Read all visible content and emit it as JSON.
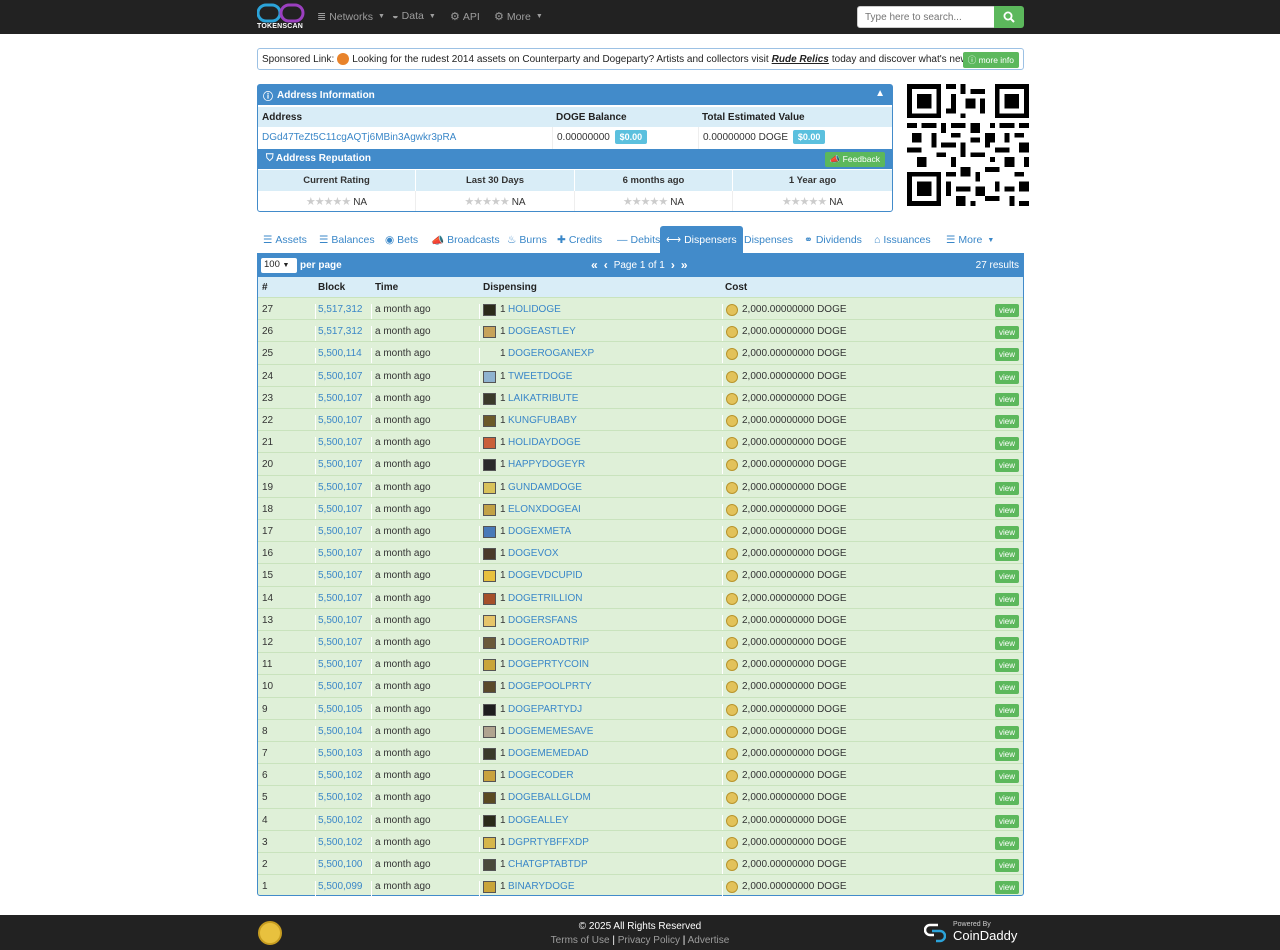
{
  "nav": {
    "logo_text": "TOKENSCAN",
    "items": [
      {
        "label": "Networks",
        "icon": "database-icon",
        "caret": true
      },
      {
        "label": "Data",
        "icon": "dashboard-icon",
        "caret": true
      },
      {
        "label": "API",
        "icon": "gears-icon",
        "caret": false
      },
      {
        "label": "More",
        "icon": "gear-icon",
        "caret": true
      }
    ],
    "search_placeholder": "Type here to search..."
  },
  "sponsor": {
    "prefix": "Sponsored Link:",
    "text_before": "Looking for the rudest 2014 assets on Counterparty and Dogeparty? Artists and collectors visit",
    "link": "Rude Relics",
    "text_after": "today and discover what's new!",
    "button": "more info"
  },
  "address_info": {
    "title": "Address Information",
    "headers": {
      "address": "Address",
      "balance": "DOGE Balance",
      "total": "Total Estimated Value"
    },
    "address": "DGd47TeZt5C11cgAQTj6MBin3Agwkr3pRA",
    "balance": "0.00000000",
    "balance_usd": "$0.00",
    "total": "0.00000000 DOGE",
    "total_usd": "$0.00"
  },
  "reputation": {
    "title": "Address Reputation",
    "feedback_button": "Feedback",
    "columns": [
      "Current Rating",
      "Last 30 Days",
      "6 months ago",
      "1 Year ago"
    ],
    "values": [
      "NA",
      "NA",
      "NA",
      "NA"
    ]
  },
  "tabs": [
    {
      "label": "Assets",
      "icon": "assets-icon"
    },
    {
      "label": "Balances",
      "icon": "list-icon"
    },
    {
      "label": "Bets",
      "icon": "bets-icon"
    },
    {
      "label": "Broadcasts",
      "icon": "bullhorn-icon"
    },
    {
      "label": "Burns",
      "icon": "fire-icon"
    },
    {
      "label": "Credits",
      "icon": "plus-icon"
    },
    {
      "label": "Debits",
      "icon": "minus-icon"
    },
    {
      "label": "Dispensers",
      "icon": "arrows-icon"
    },
    {
      "label": "Dispenses",
      "icon": ""
    },
    {
      "label": "Dividends",
      "icon": "sitemap-icon"
    },
    {
      "label": "Issuances",
      "icon": "bank-icon"
    },
    {
      "label": "More",
      "icon": "list-icon"
    }
  ],
  "active_tab": "Dispensers",
  "table": {
    "per_page": "100",
    "per_page_label": "per page",
    "page_info": "Page 1 of 1",
    "results": "27 results",
    "columns": [
      "#",
      "Block",
      "Time",
      "Dispensing",
      "Cost"
    ],
    "view_label": "view",
    "rows": [
      {
        "n": "27",
        "block": "5,517,312",
        "time": "a month ago",
        "qty": "1",
        "asset": "HOLIDOGE",
        "cost": "2,000.00000000 DOGE",
        "icon_color": "#2b2b1a"
      },
      {
        "n": "26",
        "block": "5,517,312",
        "time": "a month ago",
        "qty": "1",
        "asset": "DOGEASTLEY",
        "cost": "2,000.00000000 DOGE",
        "icon_color": "#c7a35a"
      },
      {
        "n": "25",
        "block": "5,500,114",
        "time": "a month ago",
        "qty": "1",
        "asset": "DOGEROGANEXP",
        "cost": "2,000.00000000 DOGE",
        "icon_color": ""
      },
      {
        "n": "24",
        "block": "5,500,107",
        "time": "a month ago",
        "qty": "1",
        "asset": "TWEETDOGE",
        "cost": "2,000.00000000 DOGE",
        "icon_color": "#8fb3d0"
      },
      {
        "n": "23",
        "block": "5,500,107",
        "time": "a month ago",
        "qty": "1",
        "asset": "LAIKATRIBUTE",
        "cost": "2,000.00000000 DOGE",
        "icon_color": "#3a3a2a"
      },
      {
        "n": "22",
        "block": "5,500,107",
        "time": "a month ago",
        "qty": "1",
        "asset": "KUNGFUBABY",
        "cost": "2,000.00000000 DOGE",
        "icon_color": "#6b5a2a"
      },
      {
        "n": "21",
        "block": "5,500,107",
        "time": "a month ago",
        "qty": "1",
        "asset": "HOLIDAYDOGE",
        "cost": "2,000.00000000 DOGE",
        "icon_color": "#c9603a"
      },
      {
        "n": "20",
        "block": "5,500,107",
        "time": "a month ago",
        "qty": "1",
        "asset": "HAPPYDOGEYR",
        "cost": "2,000.00000000 DOGE",
        "icon_color": "#2a2a2a"
      },
      {
        "n": "19",
        "block": "5,500,107",
        "time": "a month ago",
        "qty": "1",
        "asset": "GUNDAMDOGE",
        "cost": "2,000.00000000 DOGE",
        "icon_color": "#d8c25a"
      },
      {
        "n": "18",
        "block": "5,500,107",
        "time": "a month ago",
        "qty": "1",
        "asset": "ELONXDOGEAI",
        "cost": "2,000.00000000 DOGE",
        "icon_color": "#c2a246"
      },
      {
        "n": "17",
        "block": "5,500,107",
        "time": "a month ago",
        "qty": "1",
        "asset": "DOGEXMETA",
        "cost": "2,000.00000000 DOGE",
        "icon_color": "#4a7ab8"
      },
      {
        "n": "16",
        "block": "5,500,107",
        "time": "a month ago",
        "qty": "1",
        "asset": "DOGEVOX",
        "cost": "2,000.00000000 DOGE",
        "icon_color": "#4a3a2a"
      },
      {
        "n": "15",
        "block": "5,500,107",
        "time": "a month ago",
        "qty": "1",
        "asset": "DOGEVDCUPID",
        "cost": "2,000.00000000 DOGE",
        "icon_color": "#e8c13e"
      },
      {
        "n": "14",
        "block": "5,500,107",
        "time": "a month ago",
        "qty": "1",
        "asset": "DOGETRILLION",
        "cost": "2,000.00000000 DOGE",
        "icon_color": "#a5502a"
      },
      {
        "n": "13",
        "block": "5,500,107",
        "time": "a month ago",
        "qty": "1",
        "asset": "DOGERSFANS",
        "cost": "2,000.00000000 DOGE",
        "icon_color": "#e6c56a"
      },
      {
        "n": "12",
        "block": "5,500,107",
        "time": "a month ago",
        "qty": "1",
        "asset": "DOGEROADTRIP",
        "cost": "2,000.00000000 DOGE",
        "icon_color": "#6a5a3a"
      },
      {
        "n": "11",
        "block": "5,500,107",
        "time": "a month ago",
        "qty": "1",
        "asset": "DOGEPRTYCOIN",
        "cost": "2,000.00000000 DOGE",
        "icon_color": "#c9a53a"
      },
      {
        "n": "10",
        "block": "5,500,107",
        "time": "a month ago",
        "qty": "1",
        "asset": "DOGEPOOLPRTY",
        "cost": "2,000.00000000 DOGE",
        "icon_color": "#5a4a2a"
      },
      {
        "n": "9",
        "block": "5,500,105",
        "time": "a month ago",
        "qty": "1",
        "asset": "DOGEPARTYDJ",
        "cost": "2,000.00000000 DOGE",
        "icon_color": "#1e1e1e"
      },
      {
        "n": "8",
        "block": "5,500,104",
        "time": "a month ago",
        "qty": "1",
        "asset": "DOGEMEMESAVE",
        "cost": "2,000.00000000 DOGE",
        "icon_color": "#b0a490"
      },
      {
        "n": "7",
        "block": "5,500,103",
        "time": "a month ago",
        "qty": "1",
        "asset": "DOGEMEMEDAD",
        "cost": "2,000.00000000 DOGE",
        "icon_color": "#3a3a2a"
      },
      {
        "n": "6",
        "block": "5,500,102",
        "time": "a month ago",
        "qty": "1",
        "asset": "DOGECODER",
        "cost": "2,000.00000000 DOGE",
        "icon_color": "#c9a23e"
      },
      {
        "n": "5",
        "block": "5,500,102",
        "time": "a month ago",
        "qty": "1",
        "asset": "DOGEBALLGLDM",
        "cost": "2,000.00000000 DOGE",
        "icon_color": "#5a4a22"
      },
      {
        "n": "4",
        "block": "5,500,102",
        "time": "a month ago",
        "qty": "1",
        "asset": "DOGEALLEY",
        "cost": "2,000.00000000 DOGE",
        "icon_color": "#2a2a1a"
      },
      {
        "n": "3",
        "block": "5,500,102",
        "time": "a month ago",
        "qty": "1",
        "asset": "DGPRTYBFFXDP",
        "cost": "2,000.00000000 DOGE",
        "icon_color": "#d6b64a"
      },
      {
        "n": "2",
        "block": "5,500,100",
        "time": "a month ago",
        "qty": "1",
        "asset": "CHATGPTABTDP",
        "cost": "2,000.00000000 DOGE",
        "icon_color": "#4a4a3a"
      },
      {
        "n": "1",
        "block": "5,500,099",
        "time": "a month ago",
        "qty": "1",
        "asset": "BINARYDOGE",
        "cost": "2,000.00000000 DOGE",
        "icon_color": "#c9a53a"
      }
    ]
  },
  "footer": {
    "copyright": "© 2025 All Rights Reserved",
    "links": [
      "Terms of Use",
      "Privacy Policy",
      "Advertise"
    ],
    "powered_by": "Powered By",
    "brand": "CoinDaddy"
  },
  "colors": {
    "nav_bg": "#222222",
    "primary": "#428bca",
    "header_light": "#d9edf7",
    "row_green": "#dff0d8",
    "success": "#5cb85c",
    "info": "#5bc0de",
    "link": "#3a87c8"
  }
}
